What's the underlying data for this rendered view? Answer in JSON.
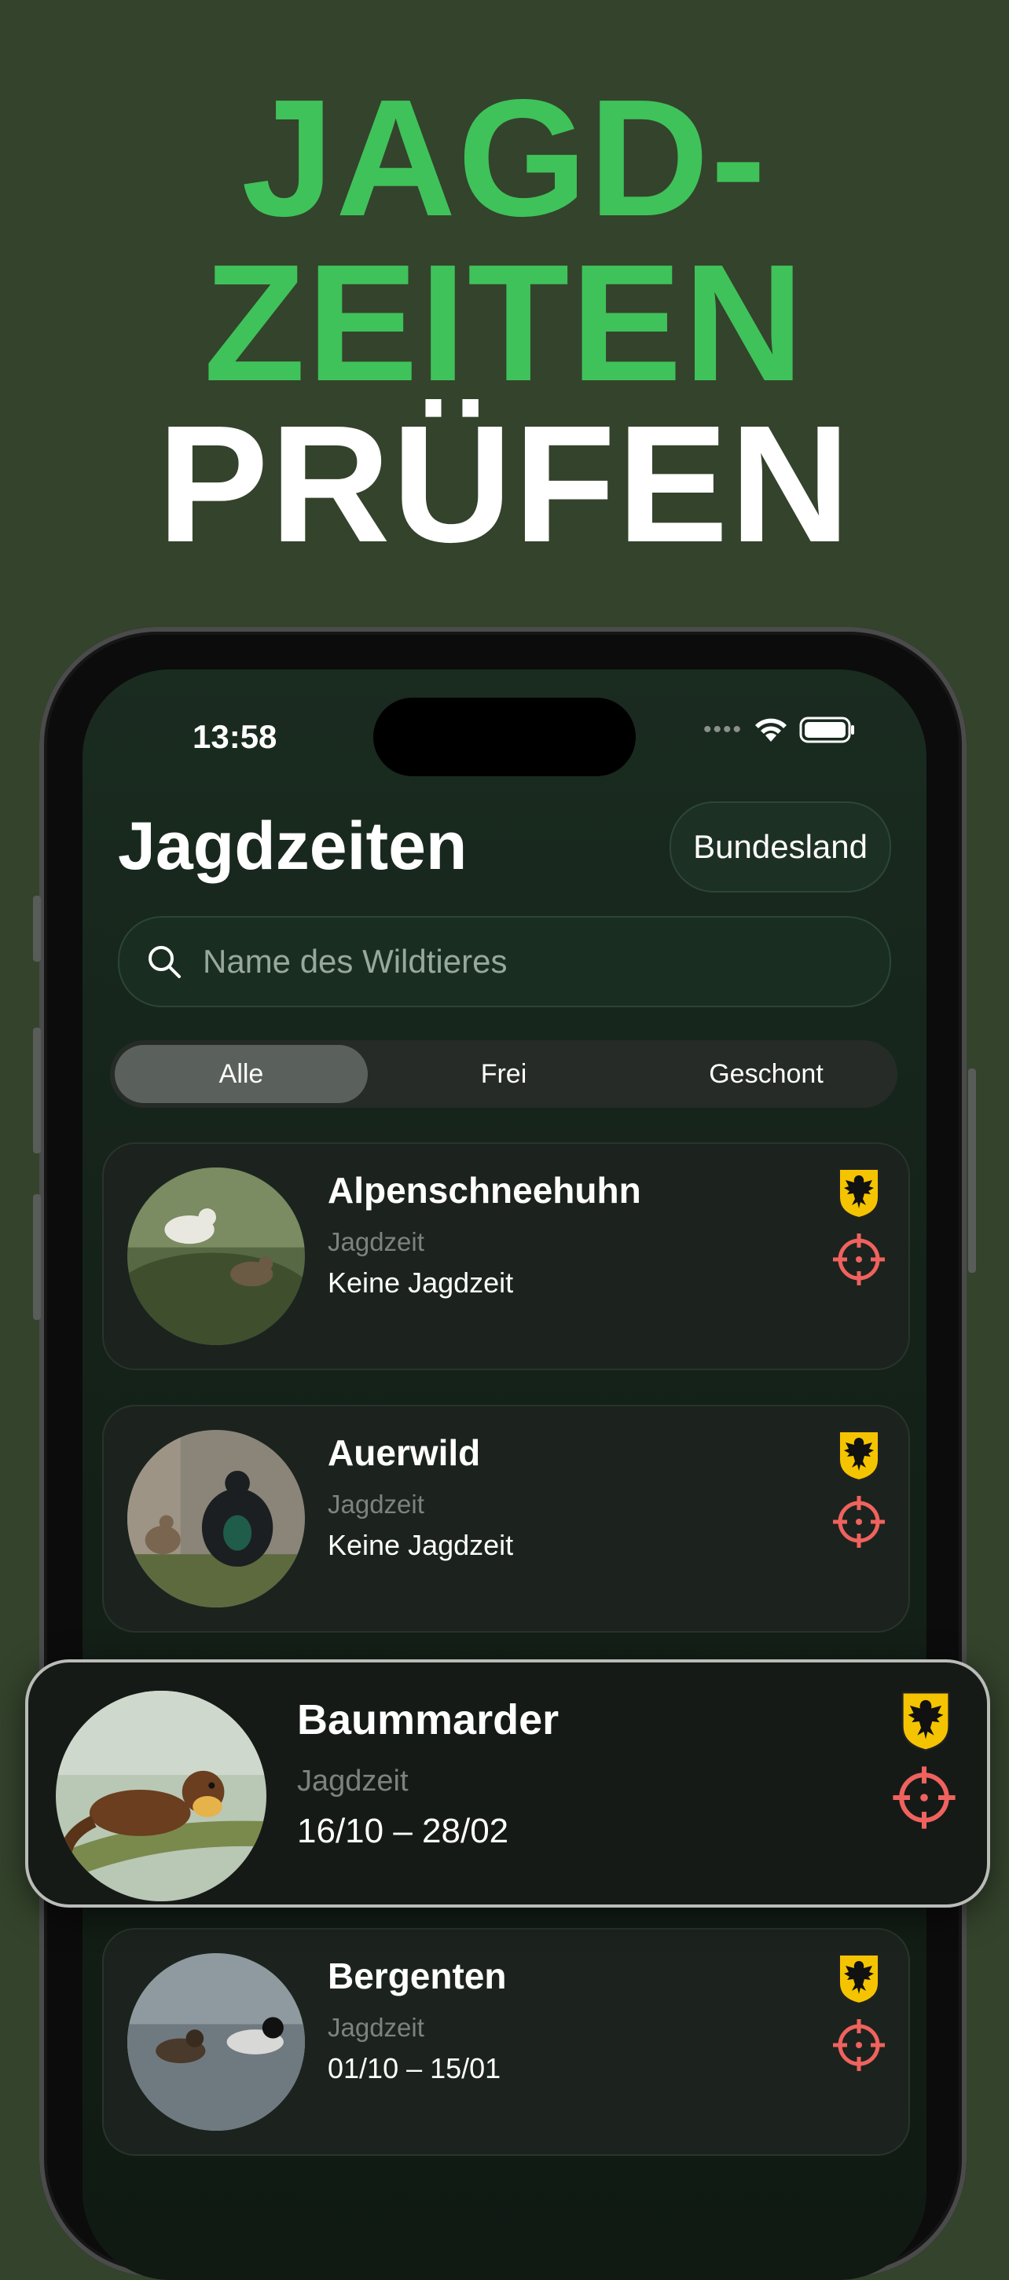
{
  "headline": {
    "line1": "JAGD-",
    "line2": "ZEITEN",
    "line3": "PRÜFEN"
  },
  "status_bar": {
    "time": "13:58"
  },
  "header": {
    "title": "Jagdzeiten",
    "filter_button": "Bundesland"
  },
  "search": {
    "placeholder": "Name des Wildtieres"
  },
  "segments": [
    {
      "label": "Alle",
      "active": true
    },
    {
      "label": "Frei",
      "active": false
    },
    {
      "label": "Geschont",
      "active": false
    }
  ],
  "animals": [
    {
      "name": "Alpenschneehuhn",
      "label": "Jagdzeit",
      "value": "Keine Jagdzeit"
    },
    {
      "name": "Auerwild",
      "label": "Jagdzeit",
      "value": "Keine Jagdzeit"
    },
    {
      "name": "Baummarder",
      "label": "Jagdzeit",
      "value": "16/10 – 28/02"
    },
    {
      "name": "Bergenten",
      "label": "Jagdzeit",
      "value": "01/10 – 15/01"
    }
  ],
  "colors": {
    "accent_green": "#3fc25a",
    "target_red": "#f0625e",
    "eagle_gold": "#f5c400"
  }
}
